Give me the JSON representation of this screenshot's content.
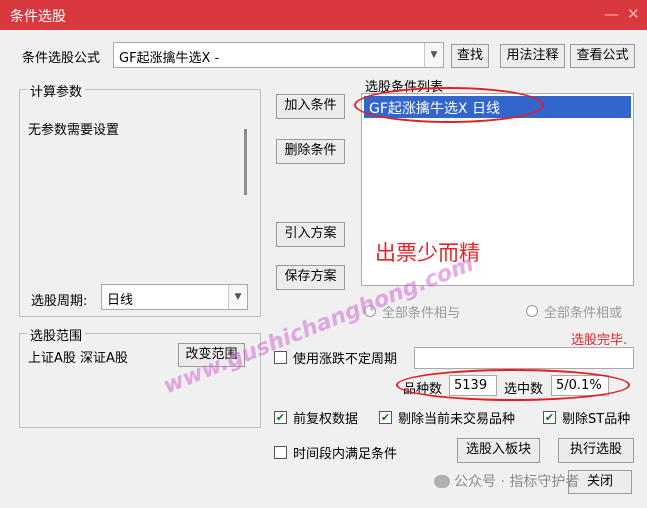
{
  "window": {
    "title": "条件选股",
    "min_icon": "minimize-icon",
    "close_icon": "close-icon"
  },
  "formula": {
    "label": "条件选股公式",
    "value": "GF起涨擒牛选X  -",
    "buttons": {
      "find": "查找",
      "usage": "用法注释",
      "view": "查看公式"
    }
  },
  "params": {
    "legend": "计算参数",
    "text": "无参数需要设置",
    "period_label": "选股周期:",
    "period_value": "日线"
  },
  "actions": {
    "add": "加入条件",
    "delete": "删除条件",
    "import": "引入方案",
    "save": "保存方案"
  },
  "conditions": {
    "legend": "选股条件列表",
    "items": [
      "GF起涨擒牛选X  日线"
    ]
  },
  "annotation": {
    "text": "出票少而精",
    "color": "#e8232b"
  },
  "logic": {
    "and_label": "全部条件相与",
    "or_label": "全部条件相或"
  },
  "status": {
    "text": "选股完毕."
  },
  "scope": {
    "legend": "选股范围",
    "value": "上证A股 深证A股",
    "change_btn": "改变范围"
  },
  "options": {
    "uncertain_period_label": "使用涨跌不定周期",
    "uncertain_period_checked": false,
    "total_label": "品种数",
    "total_value": "5139",
    "selected_label": "选中数",
    "selected_value": "5/0.1%",
    "pre_adjust_label": "前复权数据",
    "pre_adjust_checked": true,
    "exclude_untraded_label": "剔除当前未交易品种",
    "exclude_untraded_checked": true,
    "exclude_st_label": "剔除ST品种",
    "exclude_st_checked": true,
    "time_range_label": "时间段内满足条件",
    "time_range_checked": false
  },
  "bottom_buttons": {
    "to_block": "选股入板块",
    "execute": "执行选股",
    "close": "关闭"
  },
  "watermark": {
    "site": "www.gushichanghong.com",
    "wechat": "公众号 · 指标守护者"
  }
}
